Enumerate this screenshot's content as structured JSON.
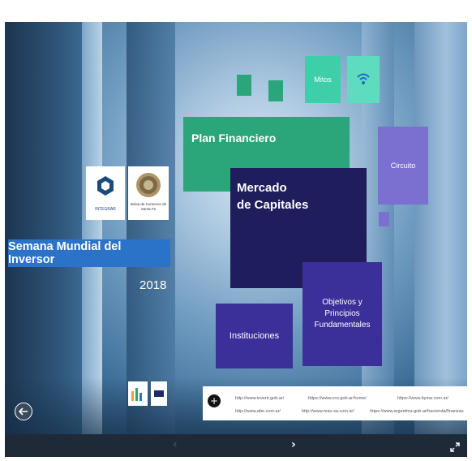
{
  "brand": {
    "integra_label": "INTEGRAR",
    "bolsa_label": "Bolsa de Comercio de Santa Fe"
  },
  "event": {
    "title": "Semana Mundial del Inversor",
    "year": "2018"
  },
  "tiles": {
    "plan_financiero": "Plan Financiero",
    "mercado_line1": "Mercado",
    "mercado_line2": "de Capitales",
    "mitos": "Mitos",
    "circuito": "Circuito",
    "instituciones": "Instituciones",
    "objetivos_line1": "Objetivos y",
    "objetivos_line2": "Principios",
    "objetivos_line3": "Fundamentales"
  },
  "links": [
    "http://www.inverti.gob.ar/",
    "https://www.cnv.gob.ar/home/",
    "https://www.byma.com.ar/",
    "http://www.abe.com.ar/",
    "http://www.mav-sa.com.ar/",
    "https://www.argentina.gob.ar/hacienda/finanzas"
  ],
  "icons": [
    "wifi-icon",
    "back-icon",
    "zoom-in-icon",
    "prev-icon",
    "next-icon",
    "fullscreen-icon"
  ],
  "colors": {
    "green": "#2aa67a",
    "mint": "#3fcfa8",
    "navy": "#1f1d5c",
    "purple": "#3b2f9a",
    "lavender": "#7b6fd0",
    "blue_banner": "#2a73c8"
  }
}
